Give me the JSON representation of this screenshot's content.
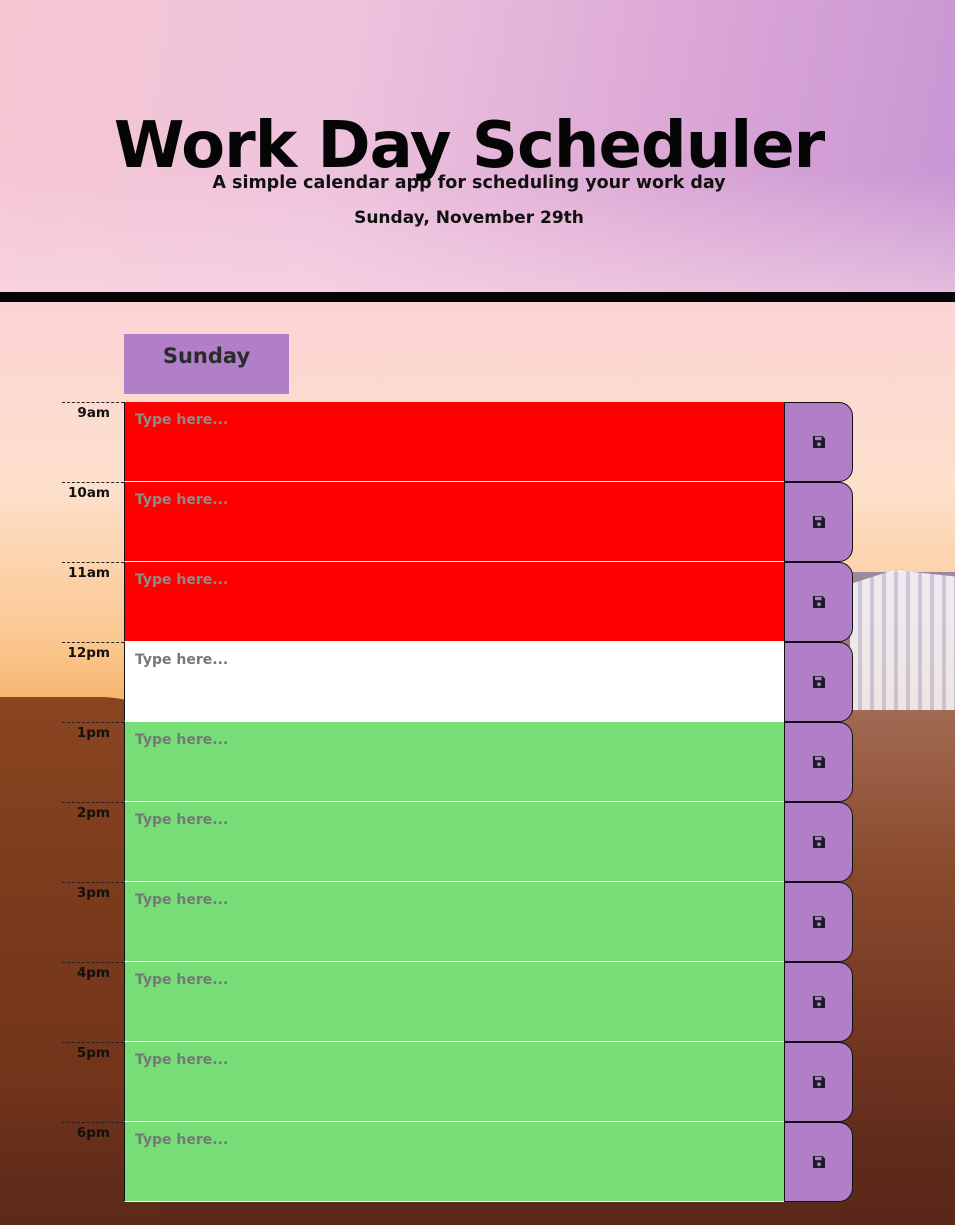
{
  "header": {
    "title": "Work Day Scheduler",
    "lead": "A simple calendar app for scheduling your work day",
    "current_day": "Sunday, November 29th"
  },
  "day_header": "Sunday",
  "placeholder": "Type here...",
  "colors": {
    "past": "#ff0000",
    "present": "#ffffff",
    "future": "#77dd77",
    "save_button": "#b07fc8",
    "day_header": "#b07fc8"
  },
  "time_blocks": [
    {
      "hour": "9am",
      "state": "past",
      "value": ""
    },
    {
      "hour": "10am",
      "state": "past",
      "value": ""
    },
    {
      "hour": "11am",
      "state": "past",
      "value": ""
    },
    {
      "hour": "12pm",
      "state": "present",
      "value": ""
    },
    {
      "hour": "1pm",
      "state": "future",
      "value": ""
    },
    {
      "hour": "2pm",
      "state": "future",
      "value": ""
    },
    {
      "hour": "3pm",
      "state": "future",
      "value": ""
    },
    {
      "hour": "4pm",
      "state": "future",
      "value": ""
    },
    {
      "hour": "5pm",
      "state": "future",
      "value": ""
    },
    {
      "hour": "6pm",
      "state": "future",
      "value": ""
    }
  ],
  "save_icon": "floppy-disk-icon"
}
